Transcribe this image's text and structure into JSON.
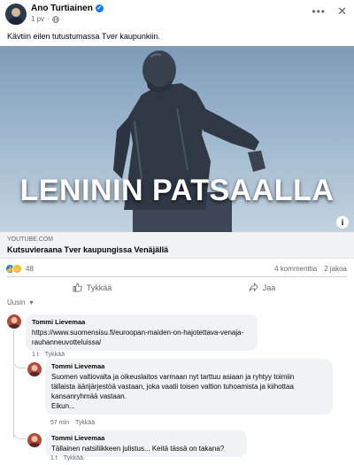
{
  "post": {
    "author": "Ano Turtiainen",
    "time": "1 pv",
    "visibility_icon": "globe-icon",
    "text": "Kävtiin eilen tutustumassa Tver kaupunkiin."
  },
  "hero": {
    "overlay_text": "LENININ PATSAALLA"
  },
  "link": {
    "domain": "YOUTUBE.COM",
    "title": "Kutsuvieraana Tver kaupungissa Venäjällä"
  },
  "engagement": {
    "reaction_count": "48",
    "comments": "4 kommenttia",
    "shares": "2 jakoa"
  },
  "actions": {
    "like": "Tykkää",
    "share": "Jaa"
  },
  "comments_sort": "Uusin",
  "comments": [
    {
      "name": "Tommi Lievemaa",
      "lines": [
        "https://www.suomensisu.fi/euroopan-maiden-on-hajotettava-venaja-",
        "rauhanneuvotteluissa/"
      ],
      "time": "1 t",
      "like": "Tykkää"
    },
    {
      "name": "Tommi Lievemaa",
      "lines": [
        "Suomen valtiovalta ja oikeuslaitos varmaan nyt tarttuu asiaan ja ryhtyy toimiin",
        "tällaista äärijärjestöä vastaan, joka vaatii toisen valtion tuhoamista ja kiihottaa",
        "kansanryhmää vastaan.",
        "Eikun..."
      ],
      "time": "57 min",
      "like": "Tykkää"
    },
    {
      "name": "Tommi Lievemaa",
      "lines": [
        "Tällainen natsiliikkeen julistus... Keitä tässä on takana?"
      ],
      "time": "1 t",
      "like": "Tykkää"
    }
  ]
}
